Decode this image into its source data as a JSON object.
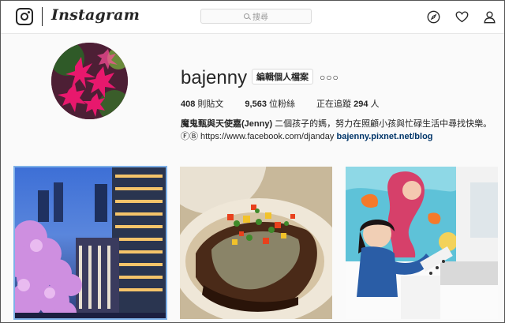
{
  "header": {
    "wordmark": "Instagram",
    "search_placeholder": "搜尋",
    "icons": [
      "instagram-camera-icon",
      "explore-compass-icon",
      "heart-icon",
      "profile-person-icon"
    ]
  },
  "profile": {
    "username": "bajenny",
    "edit_button_label": "編輯個人檔案",
    "more_label": "○○○",
    "stats": {
      "posts_count": "408",
      "posts_label": " 則貼文",
      "followers_count": "9,563",
      "followers_label": " 位粉絲",
      "following_prefix": "正在追蹤 ",
      "following_count": "294",
      "following_label": " 人"
    },
    "bio": {
      "name": "魔鬼甄與天使嘉(Jenny)",
      "description": " 二個孩子的媽，努力在照顧小孩與忙碌生活中尋找快樂。",
      "fb_prefix": "ⒻⒷ https://www.facebook.com/djanday ",
      "blog_link": "bajenny.pixnet.net/blog"
    }
  },
  "posts": [
    {
      "subject": "cherry-blossom-night-photo"
    },
    {
      "subject": "grilled-steak-dish-photo"
    },
    {
      "subject": "child-in-mermaid-room-photo"
    }
  ],
  "colors": {
    "accent_link": "#003569",
    "border": "#dbdbdb",
    "selected_outline": "#7fb1e8"
  }
}
